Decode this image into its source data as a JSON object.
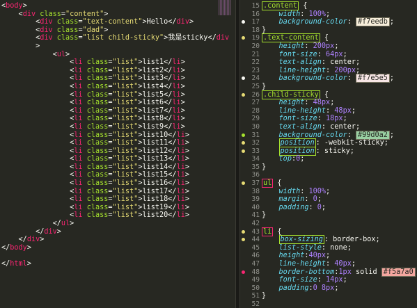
{
  "html_pane": {
    "lines": [
      "<body>",
      "    <div class=\"content\">",
      "        <div class=\"text-content\">Hello</div>",
      "        <div class=\"dad\">",
      "        <div class=\"list child-sticky\">我是sticky</div",
      "        >",
      "            <ul>",
      "                <li class=\"list\">list1</li>",
      "                <li class=\"list\">list2</li>",
      "                <li class=\"list\">list3</li>",
      "                <li class=\"list\">list4</li>",
      "                <li class=\"list\">list5</li>",
      "                <li class=\"list\">list6</li>",
      "                <li class=\"list\">list7</li>",
      "                <li class=\"list\">list8</li>",
      "                <li class=\"list\">list9</li>",
      "                <li class=\"list\">list10</li>",
      "                <li class=\"list\">list11</li>",
      "                <li class=\"list\">list12</li>",
      "                <li class=\"list\">list13</li>",
      "                <li class=\"list\">list14</li>",
      "                <li class=\"list\">list15</li>",
      "                <li class=\"list\">list16</li>",
      "                <li class=\"list\">list17</li>",
      "                <li class=\"list\">list18</li>",
      "                <li class=\"list\">list19</li>",
      "                <li class=\"list\">list20</li>",
      "            </ul>",
      "        </div>",
      "    </div>",
      "</body>",
      "",
      "</html>"
    ]
  },
  "css_pane": {
    "lines": [
      {
        "num": "15",
        "dot": "",
        "text": ".content {"
      },
      {
        "num": "16",
        "dot": "",
        "text": "    width: 100%;"
      },
      {
        "num": "17",
        "dot": "white",
        "text": "    background-color: #f7eedb;"
      },
      {
        "num": "18",
        "dot": "",
        "text": "}"
      },
      {
        "num": "19",
        "dot": "yellow",
        "text": ".text-content {"
      },
      {
        "num": "20",
        "dot": "",
        "text": "    height: 200px;"
      },
      {
        "num": "21",
        "dot": "",
        "text": "    font-size: 64px;"
      },
      {
        "num": "22",
        "dot": "",
        "text": "    text-align: center;"
      },
      {
        "num": "23",
        "dot": "",
        "text": "    line-height: 200px;"
      },
      {
        "num": "24",
        "dot": "white",
        "text": "    background-color: #f7e5e5;"
      },
      {
        "num": "25",
        "dot": "",
        "text": "}"
      },
      {
        "num": "26",
        "dot": "yellow",
        "text": ".child-sticky {"
      },
      {
        "num": "27",
        "dot": "",
        "text": "    height: 48px;"
      },
      {
        "num": "28",
        "dot": "",
        "text": "    line-height: 48px;"
      },
      {
        "num": "29",
        "dot": "",
        "text": "    font-size: 18px;"
      },
      {
        "num": "30",
        "dot": "",
        "text": "    text-align: center;"
      },
      {
        "num": "31",
        "dot": "green",
        "text": "    background-color: #99d0a2;"
      },
      {
        "num": "32",
        "dot": "yellow",
        "text": "    position: -webkit-sticky;"
      },
      {
        "num": "33",
        "dot": "yellow",
        "text": "    position: sticky;"
      },
      {
        "num": "34",
        "dot": "",
        "text": "    top:0;"
      },
      {
        "num": "35",
        "dot": "",
        "text": "}"
      },
      {
        "num": "36",
        "dot": "",
        "text": ""
      },
      {
        "num": "37",
        "dot": "yellow",
        "text": "ul {"
      },
      {
        "num": "38",
        "dot": "",
        "text": "    width: 100%;"
      },
      {
        "num": "39",
        "dot": "",
        "text": "    margin: 0;"
      },
      {
        "num": "40",
        "dot": "",
        "text": "    padding: 0;"
      },
      {
        "num": "41",
        "dot": "",
        "text": "}"
      },
      {
        "num": "42",
        "dot": "",
        "text": ""
      },
      {
        "num": "43",
        "dot": "yellow",
        "text": "li {"
      },
      {
        "num": "44",
        "dot": "yellow",
        "text": "    box-sizing: border-box;"
      },
      {
        "num": "45",
        "dot": "",
        "text": "    list-style: none;"
      },
      {
        "num": "46",
        "dot": "",
        "text": "    height:40px;"
      },
      {
        "num": "47",
        "dot": "",
        "text": "    line-height: 40px;"
      },
      {
        "num": "48",
        "dot": "red",
        "text": "    border-bottom:1px solid #f5a7a0;"
      },
      {
        "num": "49",
        "dot": "",
        "text": "    font-size: 14px;"
      },
      {
        "num": "50",
        "dot": "",
        "text": "    padding:0 8px;"
      },
      {
        "num": "51",
        "dot": "",
        "text": "}"
      },
      {
        "num": "52",
        "dot": "",
        "text": ""
      }
    ]
  },
  "colors": {
    "editor_bg": "#272822",
    "tag": "#f92672",
    "attr": "#a6e22e",
    "string": "#e6db74",
    "property": "#66d9ef",
    "value": "#ae81ff",
    "swatch_f7eedb": "#f7eedb",
    "swatch_f7e5e5": "#f7e5e5",
    "swatch_99d0a2": "#99d0a2",
    "swatch_f5a7a0": "#f5a7a0"
  }
}
